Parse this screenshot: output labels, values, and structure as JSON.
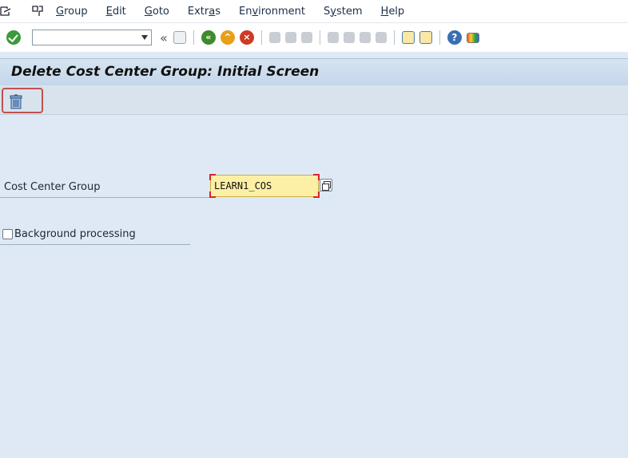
{
  "menubar": {
    "items": [
      "Group",
      "Edit",
      "Goto",
      "Extras",
      "Environment",
      "System",
      "Help"
    ],
    "underlined": [
      "G",
      "E",
      "G",
      "a",
      "v",
      "y",
      "H"
    ]
  },
  "toolbar": {
    "command_value": "",
    "icons": [
      "enter-icon",
      "save-icon",
      "back-icon",
      "exit-icon",
      "cancel-icon",
      "print-icon",
      "find-icon",
      "find-next-icon",
      "first-page-icon",
      "previous-page-icon",
      "next-page-icon",
      "last-page-icon",
      "create-session-icon",
      "shortcut-icon",
      "help-icon",
      "customize-layout-icon"
    ]
  },
  "title": "Delete Cost Center Group: Initial Screen",
  "app_toolbar": {
    "delete_icon": "trash-icon"
  },
  "form": {
    "cost_center_group_label": "Cost Center Group",
    "cost_center_group_value": "LEARN1_COS",
    "background_processing_label": "Background processing",
    "background_processing_checked": false
  }
}
